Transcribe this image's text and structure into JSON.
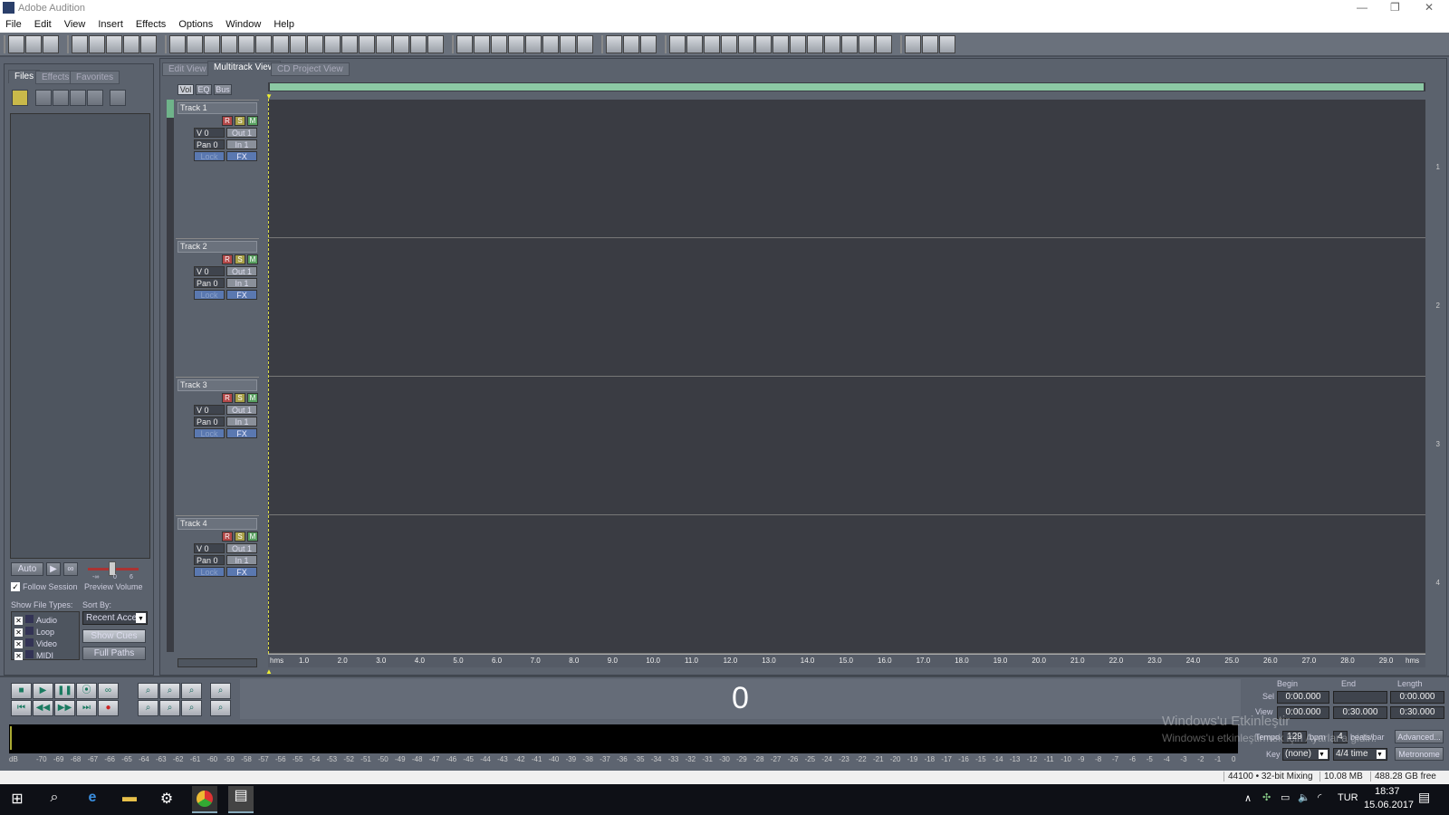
{
  "app": {
    "title": "Adobe Audition",
    "window_controls": [
      "—",
      "❐",
      "✕"
    ]
  },
  "menu": [
    "File",
    "Edit",
    "View",
    "Insert",
    "Effects",
    "Options",
    "Window",
    "Help"
  ],
  "toolbar": {
    "groups": [
      [
        "waveform-icon",
        "multitrack-icon",
        "cd-icon"
      ],
      [
        "new-icon",
        "open-icon",
        "open-append-icon",
        "save-icon",
        "save-all-icon"
      ],
      [
        "undo-icon",
        "mix-icon",
        "insert-icon",
        "trim-icon",
        "crossfade-icon",
        "envelope-icon",
        "silence-icon",
        "loop-icon",
        "group-icon",
        "split-icon",
        "align-icon",
        "fx-icon",
        "reverse-icon",
        "eq-icon",
        "pitch-icon",
        "export-icon"
      ],
      [
        "volume-envelope-icon",
        "pan-envelope-icon",
        "wet-envelope-icon",
        "fx-envelope-icon",
        "bpm-icon",
        "snap-icon",
        "lock-icon",
        "bus-icon"
      ],
      [
        "hybrid-tool-icon",
        "time-select-tool-icon",
        "move-tool-icon"
      ],
      [
        "window1-icon",
        "window2-icon",
        "mixer-icon",
        "meter-icon",
        "list-icon",
        "files-icon",
        "transport-icon",
        "zoom-icon",
        "time-icon",
        "selection-icon",
        "level-icon",
        "video-icon",
        "blank-icon"
      ],
      [
        "settings-icon",
        "help-tour-icon",
        "help-icon"
      ]
    ]
  },
  "left_panel": {
    "tabs": [
      "Files",
      "Effects",
      "Favorites"
    ],
    "active_tab": "Files",
    "auto_label": "Auto",
    "follow_session": "Follow Session",
    "follow_checked": true,
    "preview_volume": "Preview Volume",
    "vol_ticks": [
      "-∞",
      "0",
      "6"
    ],
    "show_file_types": "Show File Types:",
    "file_types": [
      {
        "name": "Audio",
        "checked": true
      },
      {
        "name": "Loop",
        "checked": true
      },
      {
        "name": "Video",
        "checked": true
      },
      {
        "name": "MIDI",
        "checked": true
      }
    ],
    "sort_by": "Sort By:",
    "sort_value": "Recent Acce",
    "show_cues": "Show Cues",
    "full_paths": "Full Paths"
  },
  "view_tabs": [
    "Edit View",
    "Multitrack View",
    "CD Project View"
  ],
  "active_view": "Multitrack View",
  "mixer_tabs": [
    "Vol",
    "EQ",
    "Bus"
  ],
  "tracks": [
    {
      "name": "Track 1",
      "vol": "V 0",
      "pan": "Pan 0",
      "out": "Out 1",
      "in": "In 1",
      "lock": "Lock",
      "fx": "FX",
      "num": "1"
    },
    {
      "name": "Track 2",
      "vol": "V 0",
      "pan": "Pan 0",
      "out": "Out 1",
      "in": "In 1",
      "lock": "Lock",
      "fx": "FX",
      "num": "2"
    },
    {
      "name": "Track 3",
      "vol": "V 0",
      "pan": "Pan 0",
      "out": "Out 1",
      "in": "In 1",
      "lock": "Lock",
      "fx": "FX",
      "num": "3"
    },
    {
      "name": "Track 4",
      "vol": "V 0",
      "pan": "Pan 0",
      "out": "Out 1",
      "in": "In 1",
      "lock": "Lock",
      "fx": "FX",
      "num": "4"
    }
  ],
  "rsm": [
    "R",
    "S",
    "M"
  ],
  "ruler": {
    "unit": "hms",
    "labels": [
      "1.0",
      "2.0",
      "3.0",
      "4.0",
      "5.0",
      "6.0",
      "7.0",
      "8.0",
      "9.0",
      "10.0",
      "11.0",
      "12.0",
      "13.0",
      "14.0",
      "15.0",
      "16.0",
      "17.0",
      "18.0",
      "19.0",
      "20.0",
      "21.0",
      "22.0",
      "23.0",
      "24.0",
      "25.0",
      "26.0",
      "27.0",
      "28.0",
      "29.0"
    ]
  },
  "counter": "0",
  "time_panel": {
    "headers": [
      "Begin",
      "End",
      "Length"
    ],
    "sel_label": "Sel",
    "view_label": "View",
    "sel": [
      "0:00.000",
      "",
      "0:00.000"
    ],
    "view": [
      "0:00.000",
      "0:30.000",
      "0:30.000"
    ],
    "tempo_label": "Tempo",
    "tempo": "129",
    "bpm": "bpm",
    "beats": "4",
    "beats_label": "beats/bar",
    "advanced": "Advanced...",
    "key_label": "Key",
    "key": "(none)",
    "time_sig": "4/4 time",
    "metronome": "Metronome"
  },
  "meter_scale": {
    "unit": "dB",
    "labels": [
      "-70",
      "-69",
      "-68",
      "-67",
      "-66",
      "-65",
      "-64",
      "-63",
      "-62",
      "-61",
      "-60",
      "-59",
      "-58",
      "-57",
      "-56",
      "-55",
      "-54",
      "-53",
      "-52",
      "-51",
      "-50",
      "-49",
      "-48",
      "-47",
      "-46",
      "-45",
      "-44",
      "-43",
      "-42",
      "-41",
      "-40",
      "-39",
      "-38",
      "-37",
      "-36",
      "-35",
      "-34",
      "-33",
      "-32",
      "-31",
      "-30",
      "-29",
      "-28",
      "-27",
      "-26",
      "-25",
      "-24",
      "-23",
      "-22",
      "-21",
      "-20",
      "-19",
      "-18",
      "-17",
      "-16",
      "-15",
      "-14",
      "-13",
      "-12",
      "-11",
      "-10",
      "-9",
      "-8",
      "-7",
      "-6",
      "-5",
      "-4",
      "-3",
      "-2",
      "-1",
      "0"
    ]
  },
  "watermark": [
    "Windows'u Etkinleştir",
    "Windows'u etkinleştirmek için Ayarlar'a gidin."
  ],
  "status": {
    "format": "44100 • 32-bit Mixing",
    "mem": "10.08 MB",
    "free": "488.28 GB free"
  },
  "taskbar": {
    "lang": "TUR",
    "time": "18:37",
    "date": "15.06.2017"
  }
}
